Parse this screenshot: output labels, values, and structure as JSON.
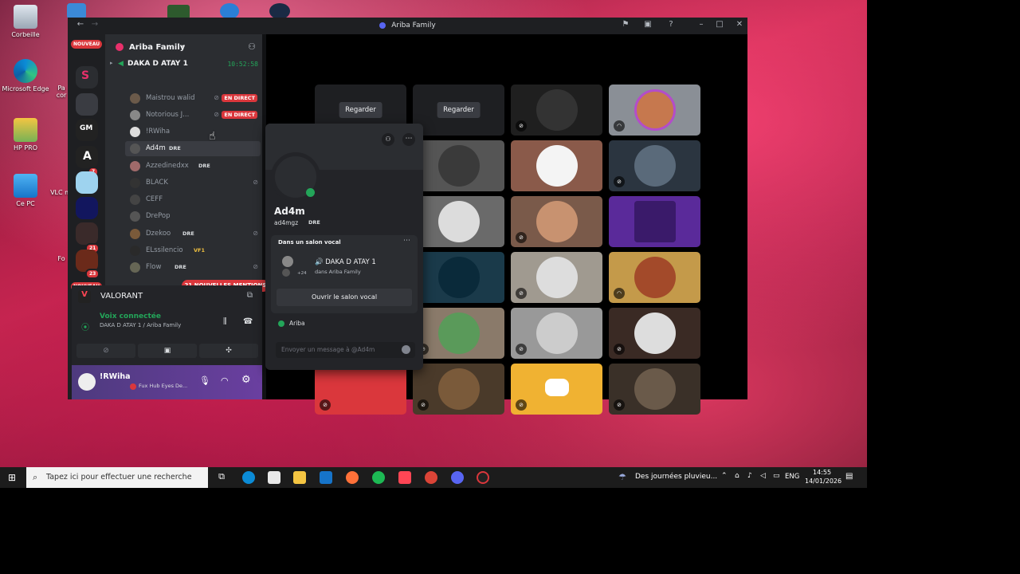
{
  "desktop": {
    "icons": [
      {
        "label": "Corbeille"
      },
      {
        "label": "Microsoft Edge"
      },
      {
        "label": "HP PRO"
      },
      {
        "label": "Ce PC"
      },
      {
        "label": "VLC m"
      },
      {
        "label": "Pa"
      },
      {
        "label": "cor"
      },
      {
        "label": "Fo"
      }
    ]
  },
  "window": {
    "title": "Ariba Family",
    "back": "←",
    "forward": "→"
  },
  "guilds": {
    "new_top": "NOUVEAU",
    "new_bottom": "NOUVEAU",
    "badges": [
      "7",
      "21",
      "23"
    ]
  },
  "server": {
    "name": "Ariba Family",
    "chevron": "⌄",
    "voice_channel": "DAKA D ATAY 1",
    "timer": "10:52:58",
    "members": [
      {
        "name": "Maistrou walid",
        "live": "EN DIRECT"
      },
      {
        "name": "Notorious J...",
        "live": "EN DIRECT"
      },
      {
        "name": "!RWiha"
      },
      {
        "name": "Ad4m",
        "tag": "DRE"
      },
      {
        "name": "Azzedinedxx",
        "tag": "DRE"
      },
      {
        "name": "BLACK"
      },
      {
        "name": "CEFF"
      },
      {
        "name": "DrePop"
      },
      {
        "name": "Dzekoo",
        "tag": "DRE"
      },
      {
        "name": "ELssilencio",
        "tag": "VF1"
      },
      {
        "name": "Flow",
        "tag": "DRE"
      }
    ],
    "mentions": "21 NOUVELLES MENTIONS"
  },
  "activity": {
    "name": "VALORANT"
  },
  "voice": {
    "status": "Voix connectée",
    "location": "DAKA D ATAY 1 / Ariba Family"
  },
  "user": {
    "name": "!RWiha",
    "status": "Fux Hub Eyes De..."
  },
  "stage": {
    "watch_label": "Regarder"
  },
  "popout": {
    "name": "Ad4m",
    "username": "ad4mgz",
    "tag": "DRE",
    "section": "Dans un salon vocal",
    "channel": "🔊 DAKA D ATAY 1",
    "server": "dans Ariba Family",
    "extra": "+24",
    "open_button": "Ouvrir le salon vocal",
    "server_tag": "Ariba",
    "message_placeholder": "Envoyer un message à @Ad4m"
  },
  "taskbar": {
    "search_placeholder": "Tapez ici pour effectuer une recherche",
    "weather": "Des journées pluvieu...",
    "lang": "ENG",
    "time": "14:55",
    "date": "14/01/2026"
  },
  "colors": {
    "accent": "#5865f2",
    "danger": "#da373c",
    "online": "#23a559"
  }
}
